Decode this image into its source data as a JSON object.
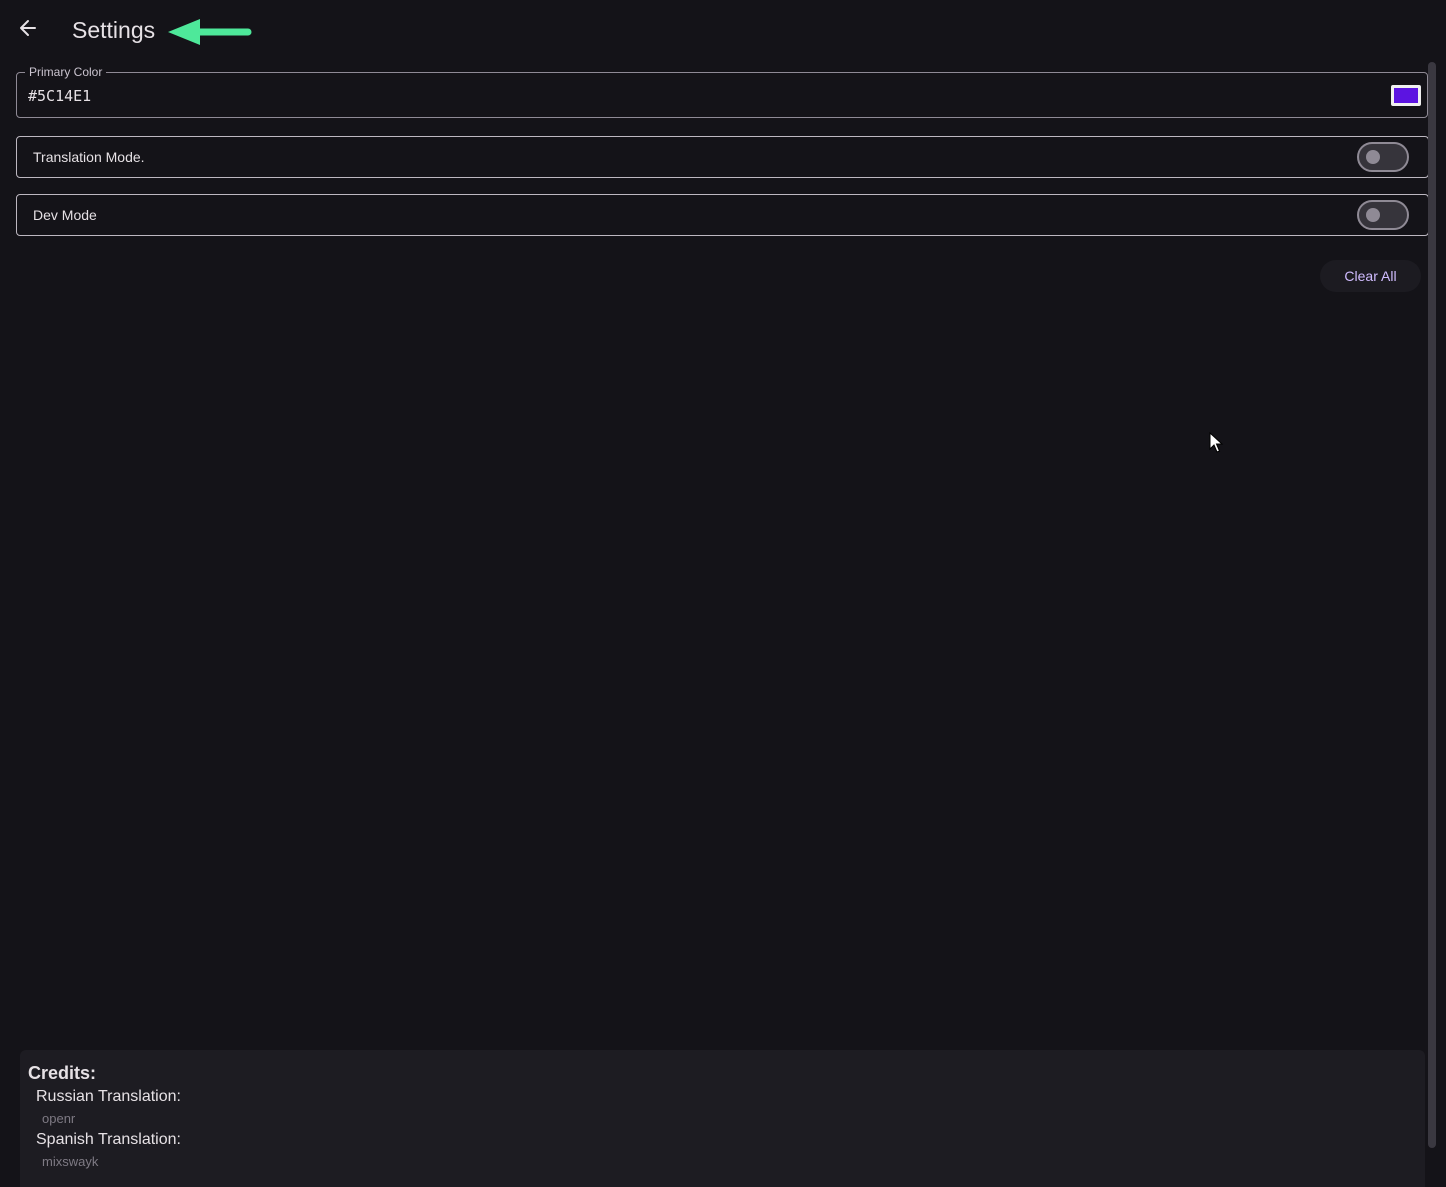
{
  "header": {
    "title": "Settings",
    "back_icon": "arrow-back-icon",
    "annotation_icon": "arrow-left-annotation-icon",
    "annotation_color": "#4ee89a"
  },
  "primary_color": {
    "label": "Primary Color",
    "value": "#5C14E1",
    "swatch_color": "#5C14E1"
  },
  "toggles": [
    {
      "label": "Translation Mode.",
      "checked": false
    },
    {
      "label": "Dev Mode",
      "checked": false
    }
  ],
  "actions": {
    "clear_all_label": "Clear All"
  },
  "credits": {
    "title": "Credits:",
    "entries": [
      {
        "heading": "Russian Translation:",
        "name": "openr"
      },
      {
        "heading": "Spanish Translation:",
        "name": "mixswayk"
      }
    ]
  },
  "colors": {
    "background": "#141318",
    "accent_text": "#d0bcff",
    "panel": "#1d1c22"
  }
}
